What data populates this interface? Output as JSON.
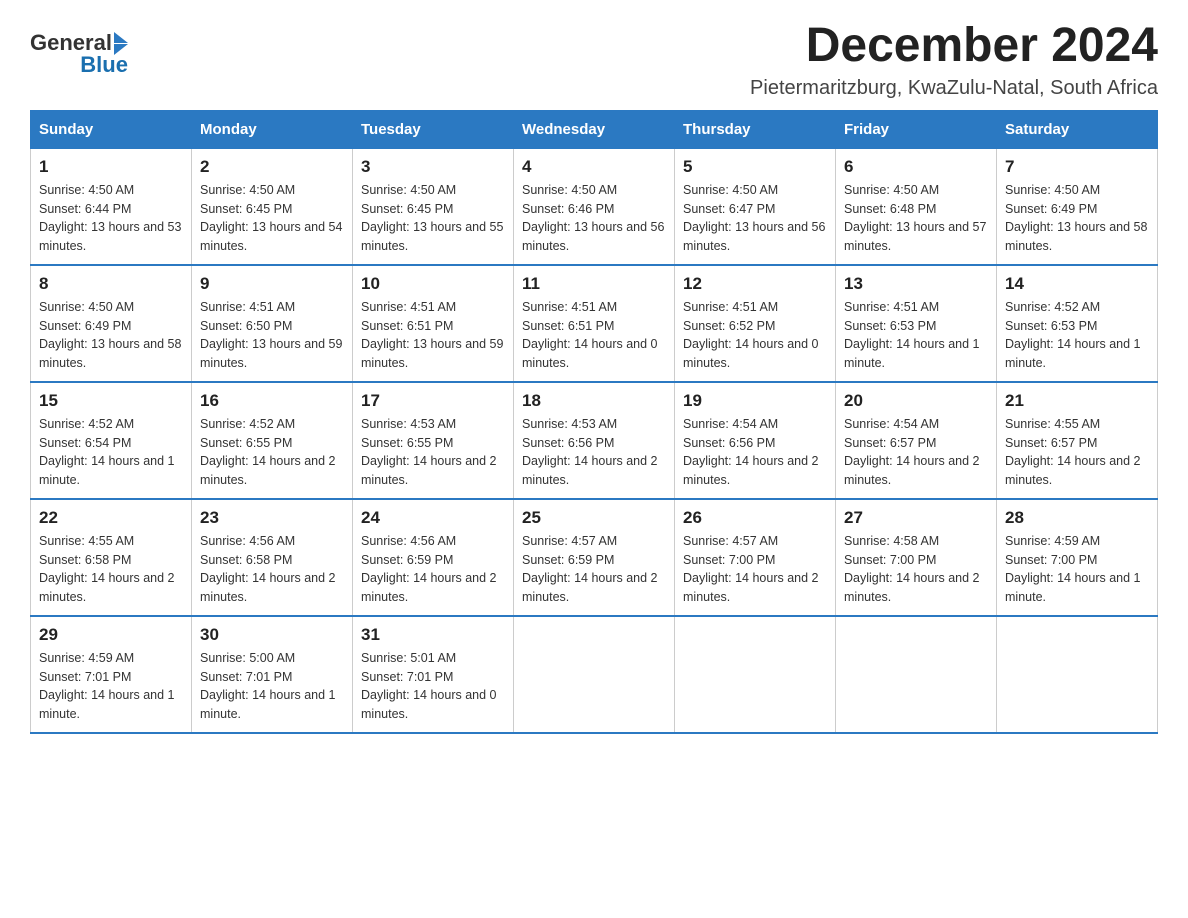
{
  "header": {
    "logo_general": "General",
    "logo_blue": "Blue",
    "month_title": "December 2024",
    "location": "Pietermaritzburg, KwaZulu-Natal, South Africa"
  },
  "days_of_week": [
    "Sunday",
    "Monday",
    "Tuesday",
    "Wednesday",
    "Thursday",
    "Friday",
    "Saturday"
  ],
  "weeks": [
    [
      {
        "day": "1",
        "sunrise": "4:50 AM",
        "sunset": "6:44 PM",
        "daylight": "13 hours and 53 minutes."
      },
      {
        "day": "2",
        "sunrise": "4:50 AM",
        "sunset": "6:45 PM",
        "daylight": "13 hours and 54 minutes."
      },
      {
        "day": "3",
        "sunrise": "4:50 AM",
        "sunset": "6:45 PM",
        "daylight": "13 hours and 55 minutes."
      },
      {
        "day": "4",
        "sunrise": "4:50 AM",
        "sunset": "6:46 PM",
        "daylight": "13 hours and 56 minutes."
      },
      {
        "day": "5",
        "sunrise": "4:50 AM",
        "sunset": "6:47 PM",
        "daylight": "13 hours and 56 minutes."
      },
      {
        "day": "6",
        "sunrise": "4:50 AM",
        "sunset": "6:48 PM",
        "daylight": "13 hours and 57 minutes."
      },
      {
        "day": "7",
        "sunrise": "4:50 AM",
        "sunset": "6:49 PM",
        "daylight": "13 hours and 58 minutes."
      }
    ],
    [
      {
        "day": "8",
        "sunrise": "4:50 AM",
        "sunset": "6:49 PM",
        "daylight": "13 hours and 58 minutes."
      },
      {
        "day": "9",
        "sunrise": "4:51 AM",
        "sunset": "6:50 PM",
        "daylight": "13 hours and 59 minutes."
      },
      {
        "day": "10",
        "sunrise": "4:51 AM",
        "sunset": "6:51 PM",
        "daylight": "13 hours and 59 minutes."
      },
      {
        "day": "11",
        "sunrise": "4:51 AM",
        "sunset": "6:51 PM",
        "daylight": "14 hours and 0 minutes."
      },
      {
        "day": "12",
        "sunrise": "4:51 AM",
        "sunset": "6:52 PM",
        "daylight": "14 hours and 0 minutes."
      },
      {
        "day": "13",
        "sunrise": "4:51 AM",
        "sunset": "6:53 PM",
        "daylight": "14 hours and 1 minute."
      },
      {
        "day": "14",
        "sunrise": "4:52 AM",
        "sunset": "6:53 PM",
        "daylight": "14 hours and 1 minute."
      }
    ],
    [
      {
        "day": "15",
        "sunrise": "4:52 AM",
        "sunset": "6:54 PM",
        "daylight": "14 hours and 1 minute."
      },
      {
        "day": "16",
        "sunrise": "4:52 AM",
        "sunset": "6:55 PM",
        "daylight": "14 hours and 2 minutes."
      },
      {
        "day": "17",
        "sunrise": "4:53 AM",
        "sunset": "6:55 PM",
        "daylight": "14 hours and 2 minutes."
      },
      {
        "day": "18",
        "sunrise": "4:53 AM",
        "sunset": "6:56 PM",
        "daylight": "14 hours and 2 minutes."
      },
      {
        "day": "19",
        "sunrise": "4:54 AM",
        "sunset": "6:56 PM",
        "daylight": "14 hours and 2 minutes."
      },
      {
        "day": "20",
        "sunrise": "4:54 AM",
        "sunset": "6:57 PM",
        "daylight": "14 hours and 2 minutes."
      },
      {
        "day": "21",
        "sunrise": "4:55 AM",
        "sunset": "6:57 PM",
        "daylight": "14 hours and 2 minutes."
      }
    ],
    [
      {
        "day": "22",
        "sunrise": "4:55 AM",
        "sunset": "6:58 PM",
        "daylight": "14 hours and 2 minutes."
      },
      {
        "day": "23",
        "sunrise": "4:56 AM",
        "sunset": "6:58 PM",
        "daylight": "14 hours and 2 minutes."
      },
      {
        "day": "24",
        "sunrise": "4:56 AM",
        "sunset": "6:59 PM",
        "daylight": "14 hours and 2 minutes."
      },
      {
        "day": "25",
        "sunrise": "4:57 AM",
        "sunset": "6:59 PM",
        "daylight": "14 hours and 2 minutes."
      },
      {
        "day": "26",
        "sunrise": "4:57 AM",
        "sunset": "7:00 PM",
        "daylight": "14 hours and 2 minutes."
      },
      {
        "day": "27",
        "sunrise": "4:58 AM",
        "sunset": "7:00 PM",
        "daylight": "14 hours and 2 minutes."
      },
      {
        "day": "28",
        "sunrise": "4:59 AM",
        "sunset": "7:00 PM",
        "daylight": "14 hours and 1 minute."
      }
    ],
    [
      {
        "day": "29",
        "sunrise": "4:59 AM",
        "sunset": "7:01 PM",
        "daylight": "14 hours and 1 minute."
      },
      {
        "day": "30",
        "sunrise": "5:00 AM",
        "sunset": "7:01 PM",
        "daylight": "14 hours and 1 minute."
      },
      {
        "day": "31",
        "sunrise": "5:01 AM",
        "sunset": "7:01 PM",
        "daylight": "14 hours and 0 minutes."
      },
      null,
      null,
      null,
      null
    ]
  ]
}
